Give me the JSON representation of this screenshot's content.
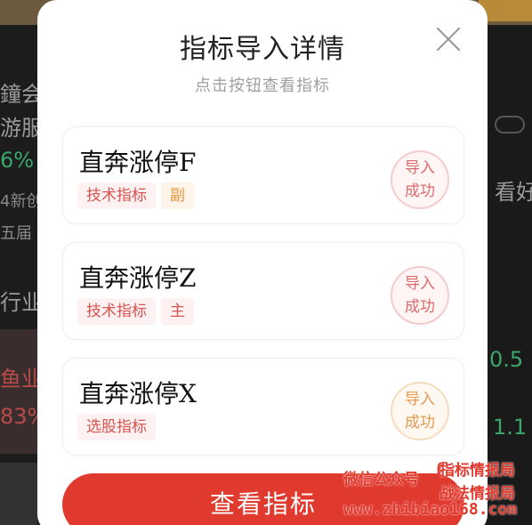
{
  "background": {
    "texts": [
      "鐘会计",
      "游服",
      "6%",
      "4新创",
      "五届",
      "行业",
      "鱼业",
      "83%",
      "看好",
      "0.5",
      "1.1"
    ]
  },
  "modal": {
    "title": "指标导入详情",
    "subtitle": "点击按钮查看指标",
    "close_icon": "close-icon",
    "items": [
      {
        "name": "直奔涨停F",
        "category": "技术指标",
        "sub_tag": "副",
        "status_line1": "导入",
        "status_line2": "成功",
        "stamp_color": "#dd6b6b",
        "sub_tag_color": "#e4963a"
      },
      {
        "name": "直奔涨停Z",
        "category": "技术指标",
        "sub_tag": "主",
        "status_line1": "导入",
        "status_line2": "成功",
        "stamp_color": "#dd6b6b",
        "sub_tag_color": "#d9534f"
      },
      {
        "name": "直奔涨停X",
        "category": "选股指标",
        "sub_tag": "",
        "status_line1": "导入",
        "status_line2": "成功",
        "stamp_color": "#e49a52",
        "sub_tag_color": ""
      }
    ],
    "view_button_label": "查看指标",
    "accent_color": "#e03a2f"
  },
  "watermark": {
    "label": "微信公众号",
    "line1": "指标情报局",
    "line2": "战法情报局",
    "url": "www.zhibiao168.com"
  }
}
